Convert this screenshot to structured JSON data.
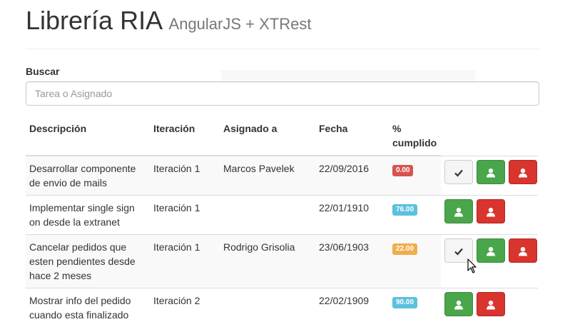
{
  "header": {
    "title": "Librería RIA",
    "subtitle": "AngularJS + XTRest"
  },
  "search": {
    "label": "Buscar",
    "placeholder": "Tarea o Asignado",
    "value": ""
  },
  "table": {
    "columns": [
      "Descripción",
      "Iteración",
      "Asignado a",
      "Fecha",
      "% cumplido"
    ],
    "rows": [
      {
        "descripcion": "Desarrollar componente de envio de mails",
        "iteracion": "Iteración 1",
        "asignado": "Marcos Pavelek",
        "fecha": "22/09/2016",
        "cumplido": "0.00",
        "badge_color": "#d9534f",
        "show_complete": true
      },
      {
        "descripcion": "Implementar single sign on desde la extranet",
        "iteracion": "Iteración 1",
        "asignado": "",
        "fecha": "22/01/1910",
        "cumplido": "76.00",
        "badge_color": "#5bc0de",
        "show_complete": false
      },
      {
        "descripcion": "Cancelar pedidos que esten pendientes desde hace 2 meses",
        "iteracion": "Iteración 1",
        "asignado": "Rodrigo Grisolia",
        "fecha": "23/06/1903",
        "cumplido": "22.00",
        "badge_color": "#f0ad4e",
        "show_complete": true
      },
      {
        "descripcion": "Mostrar info del pedido cuando esta finalizado",
        "iteracion": "Iteración 2",
        "asignado": "",
        "fecha": "22/02/1909",
        "cumplido": "90.00",
        "badge_color": "#5bc0de",
        "show_complete": false
      }
    ]
  },
  "icons": {
    "complete": "check-icon",
    "assign": "user-icon",
    "unassign": "user-icon"
  },
  "colors": {
    "success": "#49a64a",
    "danger": "#d9342d",
    "default": "#f5f5f5"
  }
}
